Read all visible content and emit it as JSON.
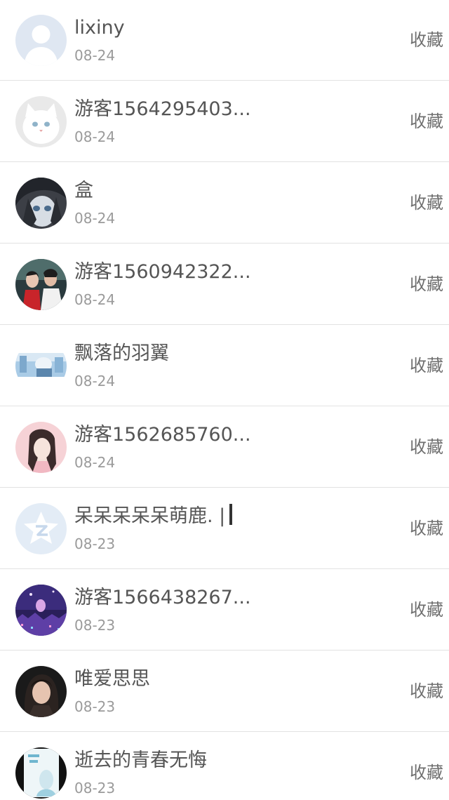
{
  "list": {
    "action_label": "收藏",
    "items": [
      {
        "name": "lixiny",
        "date": "08-24",
        "avatar": "default-user"
      },
      {
        "name": "游客1564295403...",
        "date": "08-24",
        "avatar": "white-cat"
      },
      {
        "name": "盒",
        "date": "08-24",
        "avatar": "anime-dark"
      },
      {
        "name": "游客1560942322...",
        "date": "08-24",
        "avatar": "couple-photo"
      },
      {
        "name": "飘落的羽翼",
        "date": "08-24",
        "avatar": "blue-scene"
      },
      {
        "name": "游客1562685760...",
        "date": "08-24",
        "avatar": "pink-portrait"
      },
      {
        "name": "呆呆呆呆呆萌鹿. |",
        "date": "08-23",
        "avatar": "qzone-logo"
      },
      {
        "name": "游客1566438267...",
        "date": "08-23",
        "avatar": "night-city"
      },
      {
        "name": "唯爱思思",
        "date": "08-23",
        "avatar": "dark-portrait"
      },
      {
        "name": "逝去的青春无悔",
        "date": "08-23",
        "avatar": "book-cover"
      }
    ]
  },
  "colors": {
    "name_text": "#555555",
    "date_text": "#9a9a9a",
    "action_text": "#6f6f6f",
    "divider": "#e2e2e2"
  }
}
